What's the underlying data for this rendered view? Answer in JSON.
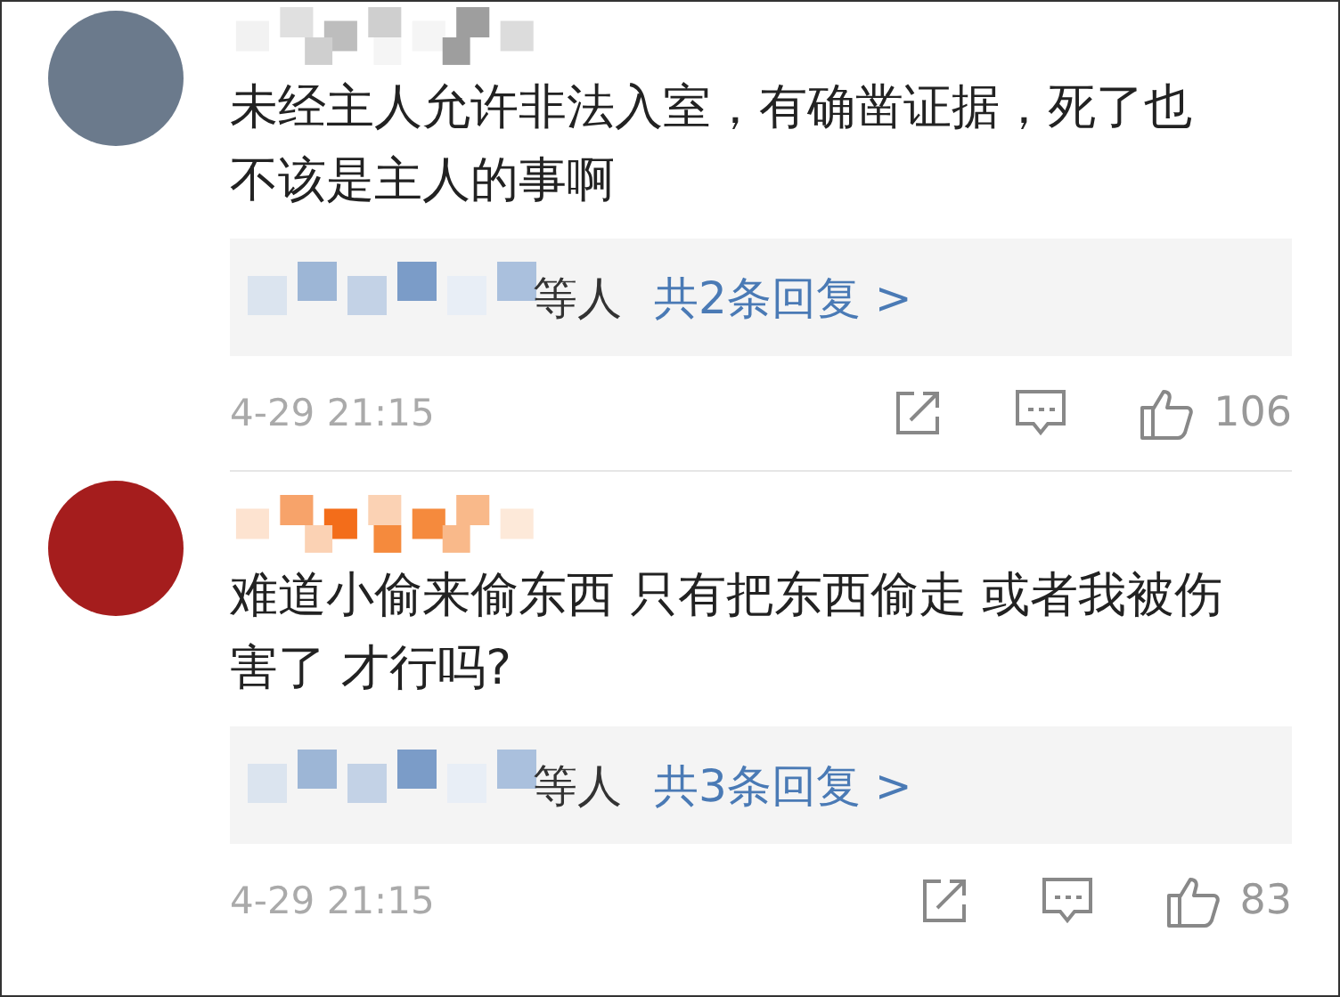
{
  "comments": [
    {
      "text": "未经主人允许非法入室，有确凿证据，死了也不该是主人的事啊",
      "reply_suffix": "等人",
      "reply_link": "共2条回复 >",
      "time": "4-29 21:15",
      "likes": "106"
    },
    {
      "text": "难道小偷来偷东西 只有把东西偷走 或者我被伤害了 才行吗?",
      "reply_suffix": "等人",
      "reply_link": "共3条回复 >",
      "time": "4-29 21:15",
      "likes": "83"
    }
  ]
}
